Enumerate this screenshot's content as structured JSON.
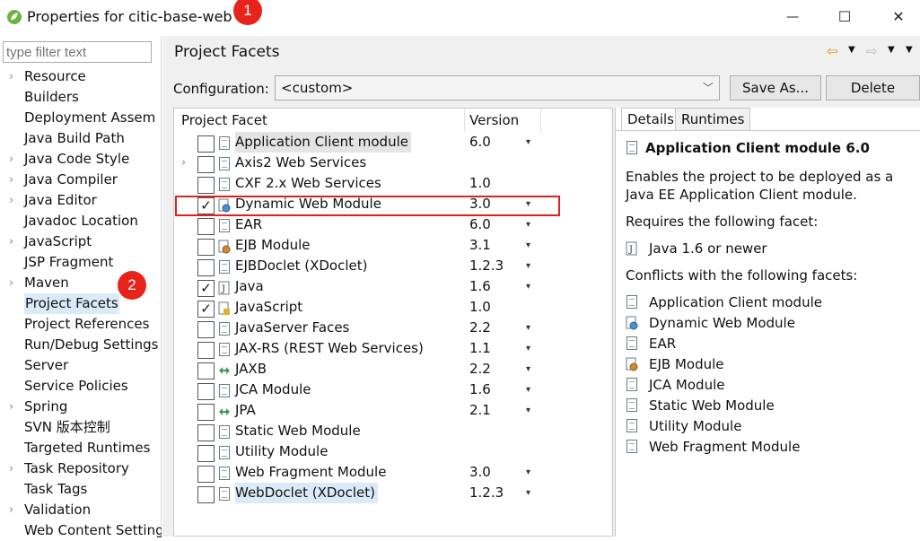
{
  "window": {
    "title": "Properties for citic-base-web",
    "minimize": "—",
    "maximize": "☐",
    "close": "✕"
  },
  "badges": {
    "one": "1",
    "two": "2"
  },
  "filter": {
    "placeholder": "type filter text"
  },
  "nav": [
    {
      "label": "Resource",
      "expandable": true
    },
    {
      "label": "Builders",
      "expandable": false
    },
    {
      "label": "Deployment Assem",
      "expandable": false
    },
    {
      "label": "Java Build Path",
      "expandable": false
    },
    {
      "label": "Java Code Style",
      "expandable": true
    },
    {
      "label": "Java Compiler",
      "expandable": true
    },
    {
      "label": "Java Editor",
      "expandable": true
    },
    {
      "label": "Javadoc Location",
      "expandable": false
    },
    {
      "label": "JavaScript",
      "expandable": true
    },
    {
      "label": "JSP Fragment",
      "expandable": false
    },
    {
      "label": "Maven",
      "expandable": true
    },
    {
      "label": "Project Facets",
      "expandable": false,
      "selected": true
    },
    {
      "label": "Project References",
      "expandable": false
    },
    {
      "label": "Run/Debug Settings",
      "expandable": false
    },
    {
      "label": "Server",
      "expandable": false
    },
    {
      "label": "Service Policies",
      "expandable": false
    },
    {
      "label": "Spring",
      "expandable": true
    },
    {
      "label": "SVN 版本控制",
      "expandable": false
    },
    {
      "label": "Targeted Runtimes",
      "expandable": false
    },
    {
      "label": "Task Repository",
      "expandable": true
    },
    {
      "label": "Task Tags",
      "expandable": false
    },
    {
      "label": "Validation",
      "expandable": true
    },
    {
      "label": "Web Content Settings",
      "expandable": false
    }
  ],
  "page": {
    "title": "Project Facets"
  },
  "config": {
    "label": "Configuration:",
    "value": "<custom>",
    "save_as": "Save As...",
    "delete": "Delete"
  },
  "facet_table": {
    "headers": {
      "facet": "Project Facet",
      "version": "Version"
    },
    "rows": [
      {
        "name": "Application Client module",
        "version": "6.0",
        "checked": false,
        "icon": "doc-icon",
        "dropdown": true,
        "hl": true
      },
      {
        "name": "Axis2 Web Services",
        "version": "",
        "checked": false,
        "icon": "doc-icon",
        "dropdown": false,
        "expand": true
      },
      {
        "name": "CXF 2.x Web Services",
        "version": "1.0",
        "checked": false,
        "icon": "doc-icon",
        "dropdown": false
      },
      {
        "name": "Dynamic Web Module",
        "version": "3.0",
        "checked": true,
        "icon": "globe-icon",
        "dropdown": true
      },
      {
        "name": "EAR",
        "version": "6.0",
        "checked": false,
        "icon": "doc-icon",
        "dropdown": true
      },
      {
        "name": "EJB Module",
        "version": "3.1",
        "checked": false,
        "icon": "bean-icon",
        "dropdown": true
      },
      {
        "name": "EJBDoclet (XDoclet)",
        "version": "1.2.3",
        "checked": false,
        "icon": "doc-icon",
        "dropdown": true
      },
      {
        "name": "Java",
        "version": "1.6",
        "checked": true,
        "icon": "java-icon",
        "dropdown": true
      },
      {
        "name": "JavaScript",
        "version": "1.0",
        "checked": true,
        "icon": "js-icon",
        "dropdown": false
      },
      {
        "name": "JavaServer Faces",
        "version": "2.2",
        "checked": false,
        "icon": "doc-icon",
        "dropdown": true
      },
      {
        "name": "JAX-RS (REST Web Services)",
        "version": "1.1",
        "checked": false,
        "icon": "doc-icon",
        "dropdown": true
      },
      {
        "name": "JAXB",
        "version": "2.2",
        "checked": false,
        "icon": "arrows-icon",
        "dropdown": true
      },
      {
        "name": "JCA Module",
        "version": "1.6",
        "checked": false,
        "icon": "doc-icon",
        "dropdown": true
      },
      {
        "name": "JPA",
        "version": "2.1",
        "checked": false,
        "icon": "arrows-icon",
        "dropdown": true
      },
      {
        "name": "Static Web Module",
        "version": "",
        "checked": false,
        "icon": "doc-icon",
        "dropdown": false
      },
      {
        "name": "Utility Module",
        "version": "",
        "checked": false,
        "icon": "doc-icon",
        "dropdown": false
      },
      {
        "name": "Web Fragment Module",
        "version": "3.0",
        "checked": false,
        "icon": "doc-icon",
        "dropdown": true
      },
      {
        "name": "WebDoclet (XDoclet)",
        "version": "1.2.3",
        "checked": false,
        "icon": "doc-icon",
        "dropdown": true,
        "sel": true
      }
    ]
  },
  "details": {
    "tabs": [
      "Details",
      "Runtimes"
    ],
    "heading": "Application Client module 6.0",
    "description": [
      "Enables the project to be deployed as a",
      "Java EE Application Client module."
    ],
    "requires_label": "Requires the following facet:",
    "requires": [
      {
        "name": "Java 1.6 or newer",
        "icon": "java-icon"
      }
    ],
    "conflicts_label": "Conflicts with the following facets:",
    "conflicts": [
      {
        "name": "Application Client module",
        "icon": "doc-icon"
      },
      {
        "name": "Dynamic Web Module",
        "icon": "globe-icon"
      },
      {
        "name": "EAR",
        "icon": "doc-icon"
      },
      {
        "name": "EJB Module",
        "icon": "bean-icon"
      },
      {
        "name": "JCA Module",
        "icon": "doc-icon"
      },
      {
        "name": "Static Web Module",
        "icon": "doc-icon"
      },
      {
        "name": "Utility Module",
        "icon": "doc-icon"
      },
      {
        "name": "Web Fragment Module",
        "icon": "doc-icon"
      }
    ]
  },
  "colors": {
    "accent_red": "#e02020",
    "selection": "#dbeaf8"
  }
}
